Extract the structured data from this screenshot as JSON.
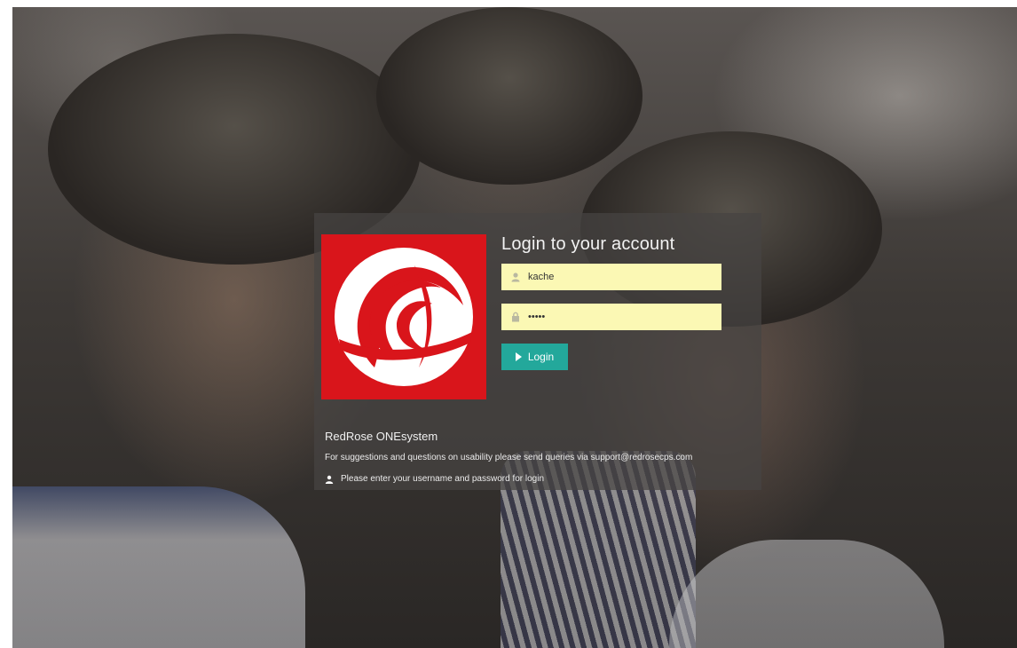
{
  "login": {
    "title": "Login to your account",
    "username_value": "kache",
    "password_value": "•••••",
    "button_label": "Login"
  },
  "footer": {
    "app_name": "RedRose ONEsystem",
    "support_text": "For suggestions and questions on usability please send queries via support@redrosecps.com",
    "hint_text": "Please enter your username and password for login"
  },
  "icons": {
    "logo": "redrose-logo",
    "username": "user-icon",
    "password": "lock-icon",
    "button": "play-icon",
    "hint": "user-icon"
  },
  "colors": {
    "logo_bg": "#d9151b",
    "input_bg": "#fbf8b4",
    "button_bg": "#23a89b",
    "panel_bg": "rgba(70,68,66,0.72)"
  }
}
